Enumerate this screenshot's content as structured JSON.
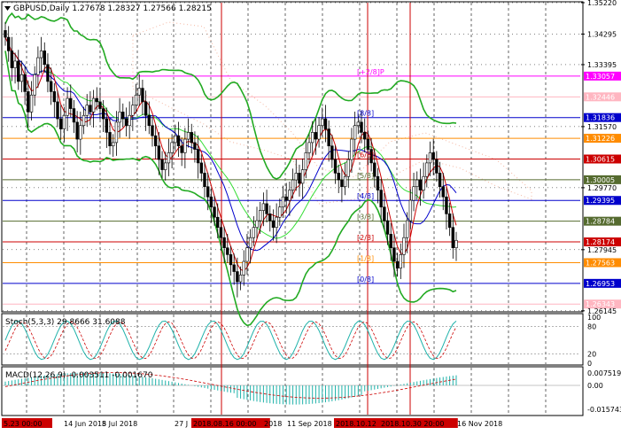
{
  "window": {
    "symbol": "GBPUSD",
    "timeframe": "Daily",
    "ohlc": "1.27678 1.28327 1.27566 1.28215"
  },
  "colors": {
    "background": "#ffffff",
    "grid": "#000000",
    "candle": "#000000",
    "bollinger": "#22aa22",
    "ma_fast": "#cc0000",
    "ma_slow": "#0000cc",
    "envelope": "#33dd33",
    "ichimoku_cloud": "#f4b6a0",
    "vline": "#cc0000"
  },
  "price_axis": {
    "ticks": [
      "1.35220",
      "1.34295",
      "1.33395",
      "1.31570",
      "1.29770",
      "1.27945",
      "1.26145"
    ]
  },
  "price_tags": [
    {
      "price": "1.33057",
      "bg": "#ff00ff",
      "fg": "#ffffff"
    },
    {
      "price": "1.32446",
      "bg": "#ffb6c1",
      "fg": "#ffffff"
    },
    {
      "price": "1.31836",
      "bg": "#0000cc",
      "fg": "#ffffff"
    },
    {
      "price": "1.31226",
      "bg": "#ff8c00",
      "fg": "#ffffff"
    },
    {
      "price": "1.30615",
      "bg": "#cc0000",
      "fg": "#ffffff"
    },
    {
      "price": "1.30005",
      "bg": "#556b2f",
      "fg": "#ffffff"
    },
    {
      "price": "1.29395",
      "bg": "#0000cc",
      "fg": "#ffffff"
    },
    {
      "price": "1.28784",
      "bg": "#556b2f",
      "fg": "#ffffff"
    },
    {
      "price": "1.28174",
      "bg": "#cc0000",
      "fg": "#ffffff"
    },
    {
      "price": "1.27563",
      "bg": "#ff8c00",
      "fg": "#ffffff"
    },
    {
      "price": "1.26953",
      "bg": "#0000cc",
      "fg": "#ffffff"
    },
    {
      "price": "1.26343",
      "bg": "#ffb6c1",
      "fg": "#ffffff"
    }
  ],
  "murrey_levels": [
    {
      "label": "[+2/8]P",
      "price": "1.33057",
      "color": "#ff00ff"
    },
    {
      "label": "[8/8]",
      "price": "1.31836",
      "color": "#0000cc"
    },
    {
      "label": "[6/8]",
      "price": "1.30615",
      "color": "#cc0000"
    },
    {
      "label": "[5/8]",
      "price": "1.30005",
      "color": "#556b2f"
    },
    {
      "label": "[4/8]",
      "price": "1.29395",
      "color": "#0000cc"
    },
    {
      "label": "[3/8]",
      "price": "1.28784",
      "color": "#556b2f"
    },
    {
      "label": "[2/8]",
      "price": "1.28174",
      "color": "#cc0000"
    },
    {
      "label": "[1/8]",
      "price": "1.27563",
      "color": "#ff8c00"
    },
    {
      "label": "[0/8]",
      "price": "1.26953",
      "color": "#0000cc"
    }
  ],
  "stoch": {
    "label": "Stoch(5,3,3) 29.8666 31.6088",
    "ticks": [
      "100",
      "80",
      "20",
      "0"
    ]
  },
  "macd": {
    "label": "MACD(12,26,9) -0.003511 -0.001670",
    "ticks": [
      "0.007519",
      "0.00",
      "-0.015743"
    ]
  },
  "time_axis": {
    "labels": [
      "5.23 00:00",
      "14 Jun 2018",
      "5 Jul 2018",
      "27 J",
      "2018.08.16 00:00",
      "2018",
      "11 Sep 2018",
      "2018.10.12",
      "2018.10.30 20:00",
      "16 Nov 2018"
    ],
    "highlighted": [
      "5.23 00:00",
      "2018.08.16 00:00",
      "2018.10.12",
      "2018.10.30 20:00"
    ]
  },
  "chart_data": {
    "type": "candlestick",
    "series": "GBPUSD Daily",
    "ylim": [
      1.2614,
      1.3522
    ],
    "closes": [
      1.342,
      1.338,
      1.333,
      1.335,
      1.329,
      1.331,
      1.326,
      1.32,
      1.325,
      1.331,
      1.336,
      1.338,
      1.334,
      1.329,
      1.326,
      1.323,
      1.318,
      1.315,
      1.319,
      1.324,
      1.321,
      1.317,
      1.312,
      1.316,
      1.319,
      1.322,
      1.32,
      1.324,
      1.323,
      1.321,
      1.318,
      1.314,
      1.31,
      1.311,
      1.317,
      1.32,
      1.318,
      1.316,
      1.319,
      1.322,
      1.325,
      1.327,
      1.323,
      1.319,
      1.316,
      1.313,
      1.31,
      1.306,
      1.303,
      1.305,
      1.308,
      1.311,
      1.313,
      1.31,
      1.308,
      1.312,
      1.314,
      1.311,
      1.309,
      1.305,
      1.302,
      1.298,
      1.295,
      1.292,
      1.289,
      1.286,
      1.283,
      1.28,
      1.278,
      1.275,
      1.273,
      1.27,
      1.272,
      1.276,
      1.28,
      1.283,
      1.286,
      1.288,
      1.291,
      1.293,
      1.29,
      1.288,
      1.286,
      1.289,
      1.292,
      1.295,
      1.294,
      1.297,
      1.3,
      1.302,
      1.299,
      1.303,
      1.308,
      1.311,
      1.314,
      1.312,
      1.316,
      1.318,
      1.315,
      1.31,
      1.306,
      1.302,
      1.3,
      1.298,
      1.301,
      1.306,
      1.312,
      1.316,
      1.317,
      1.314,
      1.312,
      1.309,
      1.305,
      1.301,
      1.297,
      1.292,
      1.288,
      1.284,
      1.28,
      1.276,
      1.274,
      1.278,
      1.283,
      1.288,
      1.294,
      1.298,
      1.3,
      1.297,
      1.301,
      1.305,
      1.308,
      1.306,
      1.302,
      1.298,
      1.295,
      1.29,
      1.286,
      1.28,
      1.2822
    ]
  }
}
